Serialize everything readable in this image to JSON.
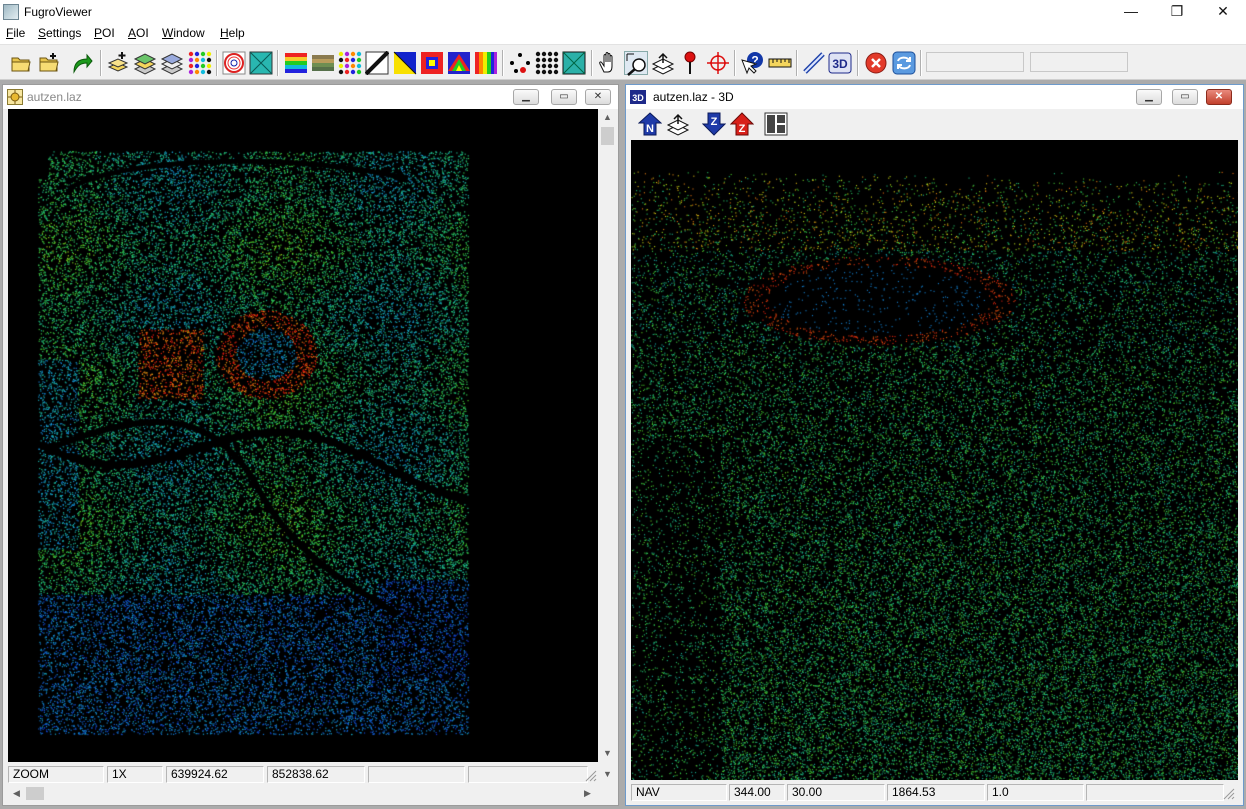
{
  "app": {
    "title": "FugroViewer",
    "minimize_glyph": "—",
    "maximize_glyph": "❐",
    "close_glyph": "✕"
  },
  "menu": [
    {
      "label": "File",
      "accel": "F",
      "rest": "ile"
    },
    {
      "label": "Settings",
      "accel": "S",
      "rest": "ettings"
    },
    {
      "label": "POI",
      "accel": "P",
      "rest": "OI"
    },
    {
      "label": "AOI",
      "accel": "A",
      "rest": "OI"
    },
    {
      "label": "Window",
      "accel": "W",
      "rest": "indow"
    },
    {
      "label": "Help",
      "accel": "H",
      "rest": "elp"
    }
  ],
  "toolbar": {
    "badge_3d": "3D",
    "field1_value": "",
    "field2_value": ""
  },
  "view2d": {
    "title": "autzen.laz",
    "status": {
      "mode": "ZOOM",
      "zoom": "1X",
      "x": "639924.62",
      "y": "852838.62",
      "extra1": "",
      "extra2": ""
    }
  },
  "view3d": {
    "title": "autzen.laz - 3D",
    "badge": "3D",
    "toolbar": {
      "n_label": "N",
      "z_down_label": "Z",
      "z_up_label": "Z"
    },
    "status": {
      "mode": "NAV",
      "v1": "344.00",
      "v2": "30.00",
      "v3": "1864.53",
      "v4": "1.0"
    }
  },
  "colors": {
    "window_bg": "#f0f0f0",
    "mdi_bg": "#ababab",
    "viewport_bg": "#000000",
    "elevation_low": "#1030c8",
    "elevation_mid": "#20c070",
    "elevation_high": "#e01010"
  }
}
